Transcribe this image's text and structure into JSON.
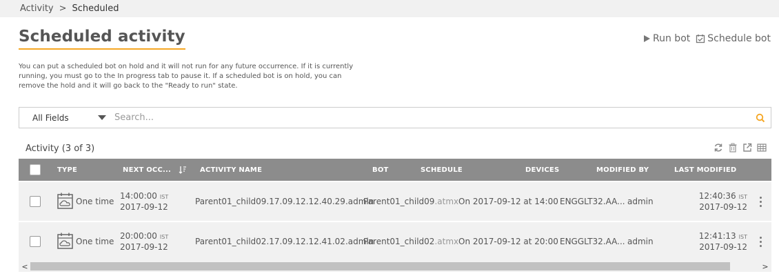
{
  "breadcrumb": {
    "parent": "Activity",
    "separator": ">",
    "current": "Scheduled"
  },
  "page": {
    "title": "Scheduled activity",
    "description": "You can put a scheduled bot on hold and it will not run for any future occurrence. If it is currently running, you must go to the In progress tab to pause it. If a scheduled bot is on hold, you can remove the hold and it will go back to the \"Ready to run\" state."
  },
  "actions": {
    "run_bot": "Run bot",
    "schedule_bot": "Schedule bot"
  },
  "search": {
    "field_selected": "All Fields",
    "placeholder": "Search..."
  },
  "table": {
    "count_label": "Activity (3 of 3)",
    "headers": {
      "type": "TYPE",
      "next_occ": "NEXT OCC...",
      "activity_name": "ACTIVITY NAME",
      "bot": "BOT",
      "schedule": "SCHEDULE",
      "devices": "DEVICES",
      "modified_by": "MODIFIED BY",
      "last_modified": "LAST MODIFIED"
    },
    "rows": [
      {
        "type": "One time",
        "next_time": "14:00:00",
        "next_tz": "IST",
        "next_date": "2017-09-12",
        "activity_name": "Parent01_child09.17.09.12.12.40.29.admin",
        "bot_name": "Parent01_child09",
        "bot_ext": ".atmx",
        "schedule": "On 2017-09-12 at 14:00",
        "devices": "ENGGLT32.AA...",
        "modified_by": "admin",
        "modified_time": "12:40:36",
        "modified_tz": "IST",
        "modified_date": "2017-09-12"
      },
      {
        "type": "One time",
        "next_time": "20:00:00",
        "next_tz": "IST",
        "next_date": "2017-09-12",
        "activity_name": "Parent01_child02.17.09.12.12.41.02.admin",
        "bot_name": "Parent01_child02",
        "bot_ext": ".atmx",
        "schedule": "On 2017-09-12 at 20:00",
        "devices": "ENGGLT32.AA...",
        "modified_by": "admin",
        "modified_time": "12:41:13",
        "modified_tz": "IST",
        "modified_date": "2017-09-12"
      }
    ]
  },
  "scrollbar": {
    "left_arrow": "<",
    "right_arrow": ">"
  },
  "colors": {
    "accent": "#f5a623",
    "header_bg": "#8c8c8c",
    "row_bg": "#f1f1f1"
  }
}
